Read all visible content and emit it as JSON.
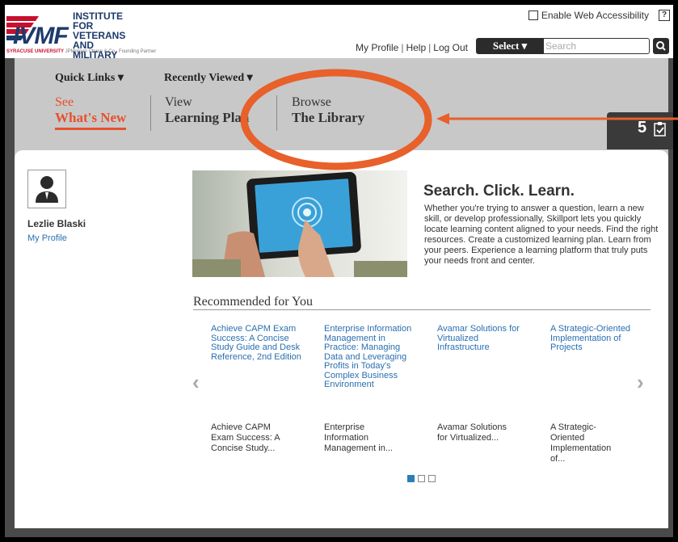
{
  "header": {
    "logo": {
      "mark": "IVMF",
      "institute_lines": [
        "INSTITUTE FOR",
        "VETERANS AND",
        "MILITARY FAMILIES"
      ],
      "university": "SYRACUSE UNIVERSITY",
      "partner": "JPMorgan Chase & Co., Founding Partner"
    },
    "accessibility_label": "Enable Web Accessibility",
    "help_icon_label": "?",
    "links": {
      "profile": "My Profile",
      "help": "Help",
      "logout": "Log Out"
    },
    "select_label": "Select ▾",
    "search_placeholder": "Search",
    "icons": {
      "search": "search-icon",
      "help": "question-icon"
    }
  },
  "nav": {
    "quick_links": "Quick Links ▾",
    "recently_viewed": "Recently Viewed ▾",
    "items": [
      {
        "top": "See",
        "bottom": "What's New",
        "active": true
      },
      {
        "top": "View",
        "bottom": "Learning Plan",
        "active": false
      },
      {
        "top": "Browse",
        "bottom": "The Library",
        "active": false
      }
    ],
    "badge_count": "5",
    "badge_icon": "checklist-icon",
    "accent_color": "#e8502a"
  },
  "user": {
    "name": "Lezlie Blaski",
    "profile_link": "My Profile"
  },
  "hero": {
    "title": "Search. Click. Learn.",
    "body": "Whether you're trying to answer a question, learn a new skill, or develop professionally, Skillport lets you quickly locate learning content aligned to your needs. Find the right resources. Create a customized learning plan. Learn from your peers. Experience a learning platform that truly puts your needs front and center."
  },
  "recommended": {
    "heading": "Recommended for You",
    "items": [
      {
        "title": "Achieve CAPM Exam Success: A Concise Study Guide and Desk Reference, 2nd Edition",
        "desc": "Achieve CAPM Exam Success: A Concise Study..."
      },
      {
        "title": "Enterprise Information Management in Practice: Managing Data and Leveraging Profits in Today's Complex Business Environment",
        "desc": "Enterprise Information Management in..."
      },
      {
        "title": "Avamar Solutions for Virtualized Infrastructure",
        "desc": "Avamar Solutions for Virtualized..."
      },
      {
        "title": "A Strategic-Oriented Implementation of Projects",
        "desc": "A Strategic-Oriented Implementation of..."
      }
    ],
    "prev_arrow": "‹",
    "next_arrow": "›",
    "pages": 3,
    "current_page": 1
  }
}
